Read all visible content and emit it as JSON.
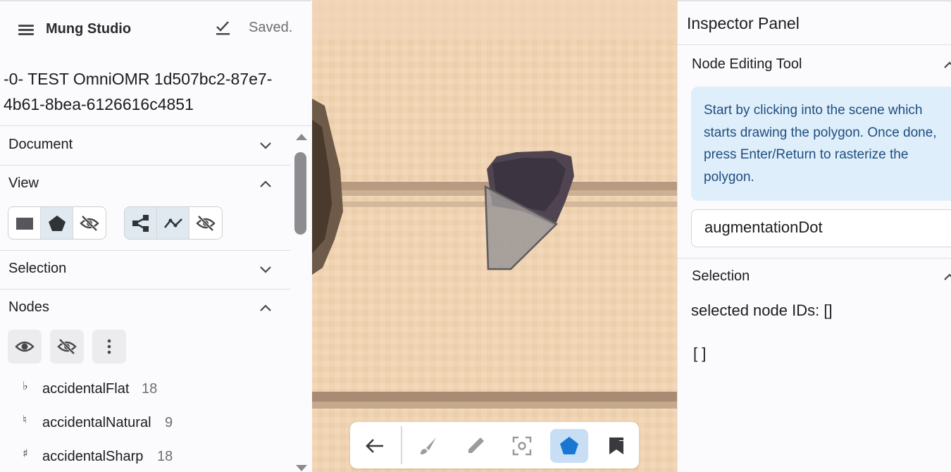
{
  "app": {
    "title": "Mung Studio",
    "saved_status": "Saved."
  },
  "document": {
    "title": "-0- TEST OmniOMR 1d507bc2-87e7-4b61-8bea-6126616c4851"
  },
  "sections": {
    "document": {
      "label": "Document",
      "expanded": false
    },
    "view": {
      "label": "View",
      "expanded": true
    },
    "selection": {
      "label": "Selection",
      "expanded": false
    },
    "nodes": {
      "label": "Nodes",
      "expanded": true
    }
  },
  "view_controls": {
    "node_display": [
      {
        "icon": "rectangle-icon",
        "active": false
      },
      {
        "icon": "polygon-icon",
        "active": true
      },
      {
        "icon": "eye-off-icon",
        "active": false
      }
    ],
    "link_display": [
      {
        "icon": "graph-links-icon",
        "active": true
      },
      {
        "icon": "polyline-icon",
        "active": true
      },
      {
        "icon": "eye-off-icon",
        "active": false
      }
    ]
  },
  "nodes_controls": [
    "eye-icon",
    "eye-off-icon",
    "more-vert-icon"
  ],
  "node_classes": [
    {
      "glyph": "♭",
      "name": "accidentalFlat",
      "count": "18"
    },
    {
      "glyph": "♮",
      "name": "accidentalNatural",
      "count": "9"
    },
    {
      "glyph": "♯",
      "name": "accidentalSharp",
      "count": "18"
    }
  ],
  "toolbar": {
    "tools": [
      "back-arrow-icon",
      "brush-icon",
      "eraser-icon",
      "focus-select-icon",
      "polygon-tool-icon",
      "bookmark-flag-icon"
    ],
    "active_tool": "polygon-tool-icon",
    "accent_color": "#1976d2"
  },
  "inspector": {
    "title": "Inspector Panel",
    "node_tool": {
      "title": "Node Editing Tool",
      "info": "Start by clicking into the scene which starts drawing the polygon. Once done, press Enter/Return to rasterize the polygon.",
      "class_value": "augmentationDot"
    },
    "selection": {
      "title": "Selection",
      "ids_label": "selected node IDs: []",
      "ids_array": "[ ]"
    }
  },
  "colors": {
    "panel_bg": "#fbfbfd",
    "info_bg": "#dfeefb",
    "info_text": "#1f4e7d",
    "active_tool_bg": "#c8def5",
    "canvas_paper": "#efd3b3"
  }
}
